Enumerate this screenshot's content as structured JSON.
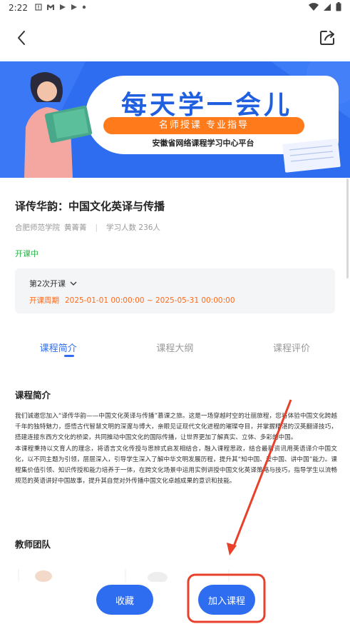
{
  "status_bar": {
    "time": "2:22",
    "left_icons": [
      "warning-square-icon",
      "gmail-icon",
      "play-store-icon",
      "play-store-icon",
      "dot-icon"
    ],
    "right_icons": [
      "wifi-icon",
      "signal-icon",
      "battery-icon"
    ]
  },
  "banner": {
    "title": "每天学一会儿",
    "pill": "名师授课  专业指导",
    "subtitle": "安徽省网络课程学习中心平台",
    "colors": {
      "background": "#2f6df0",
      "accent": "#ff7a1a",
      "title": "#1f5fe0"
    }
  },
  "course": {
    "title": "译传华韵：中国文化英译与传播",
    "school": "合肥师范学院",
    "teacher": "黄菁菁",
    "learners": "学习人数 236人",
    "status": "开课中",
    "session": "第2次开课",
    "period_label": "开课周期",
    "period_value": "2025-01-01 00:00:00 ~ 2025-05-31 00:00:00"
  },
  "tabs": [
    {
      "label": "课程简介",
      "active": true
    },
    {
      "label": "课程大纲",
      "active": false
    },
    {
      "label": "课程评价",
      "active": false
    }
  ],
  "intro": {
    "heading": "课程简介",
    "paragraph1": "我们诚邀您加入“译传华韵——中国文化英译与传播”慕课之旅。这是一场穿越时空的壮丽旅程，您将体验中国文化跨越千年的独特魅力，感悟古代智慧文明的深邃与博大，亲眼见证现代文化进程的璀璨夺目，并掌握精湛的汉英翻译技巧，搭建连接东西方文化的桥梁，共同推动中国文化的国际传播，让世界更加了解真实、立体、多彩的中国。",
    "paragraph2": "本课程秉持以文育人的理念，将语言文化传授与思辨式启发相结合，融入课程思政，结合最新资讯用英语译介中国文化，以不同主题为引领，层层深入，引导学生深入了解中华文明发展历程，提升其“知中国、爱中国、讲中国”能力。课程集价值引领、知识传授和能力培养于一体，在跨文化场景中运用实例讲授中国文化英译策略与技巧，指导学生以流畅规范的英语讲好中国故事，提升其自觉对外传播中国文化卓越成果的意识和技能。"
  },
  "team": {
    "heading": "教师团队"
  },
  "actions": {
    "favorite": "收藏",
    "join": "加入课程"
  }
}
